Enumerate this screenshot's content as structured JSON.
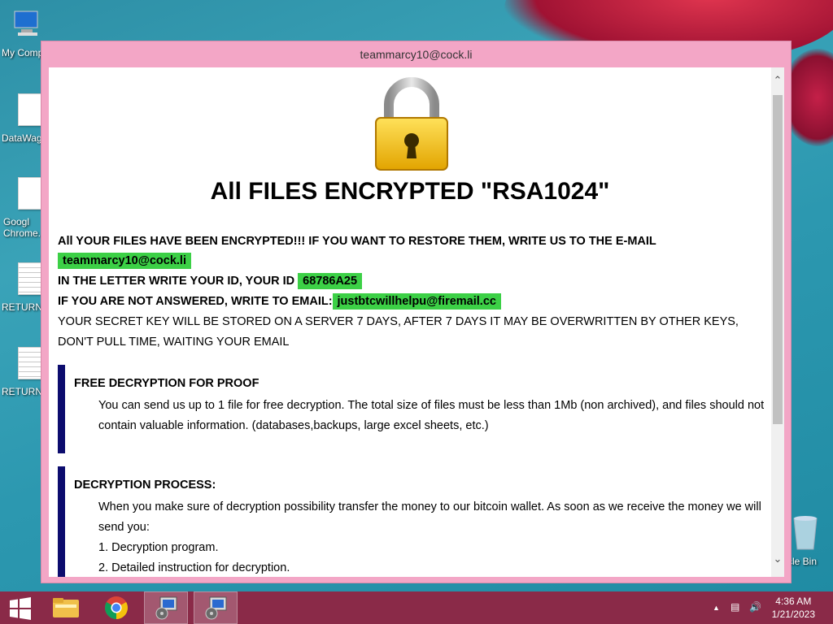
{
  "desktop": {
    "icons": [
      {
        "label": "My Comp",
        "name": "desktop-icon-my-computer"
      },
      {
        "label": "DataWag",
        "name": "desktop-icon-datawag"
      },
      {
        "label": "Googl\nChrome.",
        "name": "desktop-icon-google-chrome"
      },
      {
        "label": "RETURN",
        "name": "desktop-icon-return-1"
      },
      {
        "label": "RETURN",
        "name": "desktop-icon-return-2"
      }
    ],
    "recycle_label": "cle Bin"
  },
  "window": {
    "title": "teammarcy10@cock.li",
    "headline": "All FILES ENCRYPTED \"RSA1024\"",
    "line1": "All YOUR FILES HAVE BEEN ENCRYPTED!!! IF YOU WANT TO RESTORE THEM, WRITE US TO THE E-MAIL",
    "email_primary": "teammarcy10@cock.li",
    "line_id": "IN THE LETTER WRITE YOUR ID, YOUR ID",
    "user_id": "68786A25",
    "line_alt": "IF YOU ARE NOT ANSWERED, WRITE TO EMAIL:",
    "email_secondary": "justbtcwillhelpu@firemail.cc",
    "line_key1": "YOUR SECRET KEY WILL BE STORED ON A SERVER 7 DAYS, AFTER 7 DAYS IT MAY BE OVERWRITTEN BY OTHER KEYS,",
    "line_key2": "DON'T PULL TIME, WAITING YOUR EMAIL",
    "sections": [
      {
        "heading": "FREE DECRYPTION FOR PROOF",
        "body": "You can send us up to 1 file for free decryption. The total size of files must be less than 1Mb (non archived), and files should not contain valuable information. (databases,backups, large excel sheets, etc.)"
      },
      {
        "heading": "DECRYPTION PROCESS:",
        "body": "When you make sure of decryption possibility transfer the money to our bitcoin wallet. As soon as we receive the money we will send you:",
        "items": [
          "1. Decryption program.",
          "2. Detailed instruction for decryption."
        ]
      }
    ]
  },
  "taskbar": {
    "time": "4:36 AM",
    "date": "1/21/2023"
  },
  "colors": {
    "highlight": "#3cd046",
    "section_bar": "#0c0c6e",
    "window_frame": "#f3a6c6",
    "taskbar": "#8a2a48"
  }
}
